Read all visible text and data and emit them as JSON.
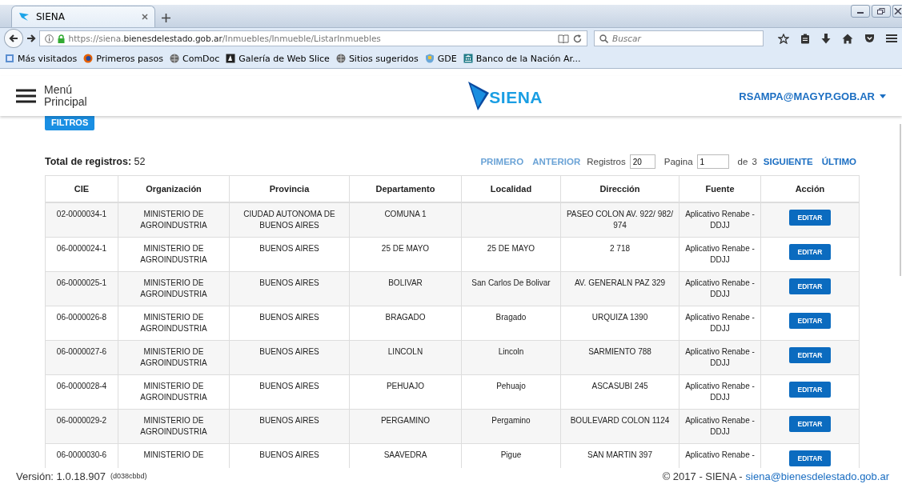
{
  "browser": {
    "tab": {
      "title": "SIENA"
    },
    "url": {
      "scheme": "https://siena.",
      "host": "bienesdelestado.gob.ar",
      "path": "/Inmuebles/Inmueble/ListarInmuebles"
    },
    "search": {
      "placeholder": "Buscar"
    },
    "bookmarks": [
      {
        "label": "Más visitados",
        "kind": "page"
      },
      {
        "label": "Primeros pasos",
        "kind": "firefox"
      },
      {
        "label": "ComDoc",
        "kind": "globe"
      },
      {
        "label": "Galería de Web Slice",
        "kind": "slice"
      },
      {
        "label": "Sitios sugeridos",
        "kind": "globe"
      },
      {
        "label": "GDE",
        "kind": "shield"
      },
      {
        "label": "Banco de la Nación Ar...",
        "kind": "bank"
      }
    ]
  },
  "header": {
    "menu_label": "Menú Principal",
    "logo": "SIENA",
    "user": "RSAMPA@MAGYP.GOB.AR"
  },
  "filters_button": "FILTROS",
  "summary": "**Total de registros:** 52",
  "pagination": {
    "first": {
      "label": "PRIMERO",
      "disabled": true
    },
    "previous": {
      "label": "ANTERIOR",
      "disabled": true
    },
    "records_label": "Registros",
    "records_value": "20",
    "page_label": "Pagina",
    "page_value": "1",
    "of_label": "de",
    "page_count": "3",
    "next": {
      "label": "SIGUIENTE",
      "disabled": false
    },
    "last": {
      "label": "ÚLTIMO",
      "disabled": false
    }
  },
  "table": {
    "columns": [
      "CIE",
      "Organización",
      "Provincia",
      "Departamento",
      "Localidad",
      "Dirección",
      "Fuente",
      "Acción"
    ],
    "rows": [
      {
        "cie": "02-0000034-1",
        "organizacion": "MINISTERIO DE AGROINDUSTRIA",
        "provincia": "CIUDAD AUTONOMA DE BUENOS AIRES",
        "departamento": "COMUNA 1",
        "localidad": "",
        "direccion": "PASEO COLON AV. 922/ 982/ 974",
        "fuente": "Aplicativo Renabe - DDJJ",
        "action": "EDITAR"
      },
      {
        "cie": "06-0000024-1",
        "organizacion": "MINISTERIO DE AGROINDUSTRIA",
        "provincia": "BUENOS AIRES",
        "departamento": "25 DE MAYO",
        "localidad": "25 DE MAYO",
        "direccion": "2 718",
        "fuente": "Aplicativo Renabe - DDJJ",
        "action": "EDITAR"
      },
      {
        "cie": "06-0000025-1",
        "organizacion": "MINISTERIO DE AGROINDUSTRIA",
        "provincia": "BUENOS AIRES",
        "departamento": "BOLIVAR",
        "localidad": "San Carlos De Bolivar",
        "direccion": "AV. GENERALN PAZ 329",
        "fuente": "Aplicativo Renabe - DDJJ",
        "action": "EDITAR"
      },
      {
        "cie": "06-0000026-8",
        "organizacion": "MINISTERIO DE AGROINDUSTRIA",
        "provincia": "BUENOS AIRES",
        "departamento": "BRAGADO",
        "localidad": "Bragado",
        "direccion": "URQUIZA 1390",
        "fuente": "Aplicativo Renabe - DDJJ",
        "action": "EDITAR"
      },
      {
        "cie": "06-0000027-6",
        "organizacion": "MINISTERIO DE AGROINDUSTRIA",
        "provincia": "BUENOS AIRES",
        "departamento": "LINCOLN",
        "localidad": "Lincoln",
        "direccion": "SARMIENTO 788",
        "fuente": "Aplicativo Renabe - DDJJ",
        "action": "EDITAR"
      },
      {
        "cie": "06-0000028-4",
        "organizacion": "MINISTERIO DE AGROINDUSTRIA",
        "provincia": "BUENOS AIRES",
        "departamento": "PEHUAJO",
        "localidad": "Pehuajo",
        "direccion": "ASCASUBI 245",
        "fuente": "Aplicativo Renabe - DDJJ",
        "action": "EDITAR"
      },
      {
        "cie": "06-0000029-2",
        "organizacion": "MINISTERIO DE AGROINDUSTRIA",
        "provincia": "BUENOS AIRES",
        "departamento": "PERGAMINO",
        "localidad": "Pergamino",
        "direccion": "BOULEVARD COLON 1124",
        "fuente": "Aplicativo Renabe - DDJJ",
        "action": "EDITAR"
      },
      {
        "cie": "06-0000030-6",
        "organizacion": "MINISTERIO DE",
        "provincia": "BUENOS AIRES",
        "departamento": "SAAVEDRA",
        "localidad": "Pigue",
        "direccion": "SAN MARTIN 397",
        "fuente": "Aplicativo Renabe -",
        "action": "EDITAR"
      }
    ]
  },
  "footer": {
    "version": "Versión: 1.0.18.907",
    "build": "(d038cbbd)",
    "copyright": "© 2017 - SIENA - ",
    "email": "siena@bienesdelestado.gob.ar"
  }
}
